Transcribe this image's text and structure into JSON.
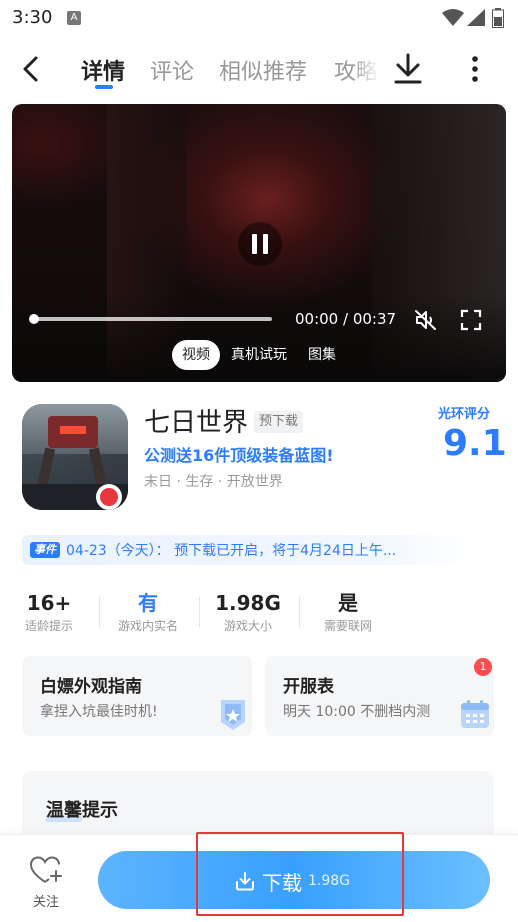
{
  "status_bar": {
    "time": "3:30",
    "notification_icon": "A"
  },
  "nav": {
    "tabs": [
      {
        "label": "详情"
      },
      {
        "label": "评论"
      },
      {
        "label": "相似推荐"
      },
      {
        "label": "攻略"
      }
    ],
    "active_tab": 0
  },
  "video": {
    "time": "00:00 / 00:37",
    "progress": 0,
    "media_tabs": [
      "视频",
      "真机试玩",
      "图集"
    ]
  },
  "game": {
    "title": "七日世界",
    "badge": "预下载",
    "promo": "公测送16件顶级装备蓝图!",
    "tags": "末日 · 生存 · 开放世界",
    "rating_label": "光环评分",
    "rating": "9.1"
  },
  "event": {
    "tag": "事件",
    "text": "04-23（今天）：  预下载已开启，将于4月24日上午..."
  },
  "stats": [
    {
      "value": "16+",
      "label": "适龄提示"
    },
    {
      "value": "有",
      "label": "游戏内实名"
    },
    {
      "value": "1.98G",
      "label": "游戏大小"
    },
    {
      "value": "是",
      "label": "需要联网"
    }
  ],
  "cards": [
    {
      "title": "白嫖外观指南",
      "subtitle": "拿捏入坑最佳时机!"
    },
    {
      "title": "开服表",
      "subtitle": "明天 10:00 不删档内测",
      "badge": "1"
    }
  ],
  "tips": {
    "title": "温馨提示"
  },
  "bottom": {
    "follow_label": "关注",
    "download_label": "下载",
    "download_size": "1.98G"
  },
  "colors": {
    "accent": "#2c7cff",
    "button": "#38a0ff",
    "badge_red": "#ff4d4f",
    "highlight_border": "#e53935"
  }
}
